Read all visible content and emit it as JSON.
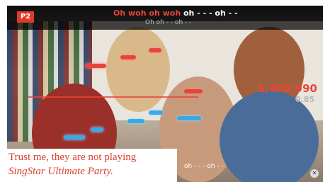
{
  "player_badge": "P2",
  "lyrics": {
    "line1_sung": "Oh woh oh woh",
    "line1_rest": " oh - - - oh - -",
    "line2": "Oh oh - - oh - -",
    "bottom1": "oh - - - oh - -",
    "bottom2": "- - -"
  },
  "score": {
    "main": "1,400,990",
    "secondary": "0.85"
  },
  "corner_icon": "close-icon",
  "caption": {
    "line1": "Trust me, they are not playing",
    "line2": "SingStar Ultimate Party."
  },
  "colors": {
    "accent": "#e8453a",
    "note_blue": "#3aa9e8",
    "caption": "#d8412f"
  }
}
